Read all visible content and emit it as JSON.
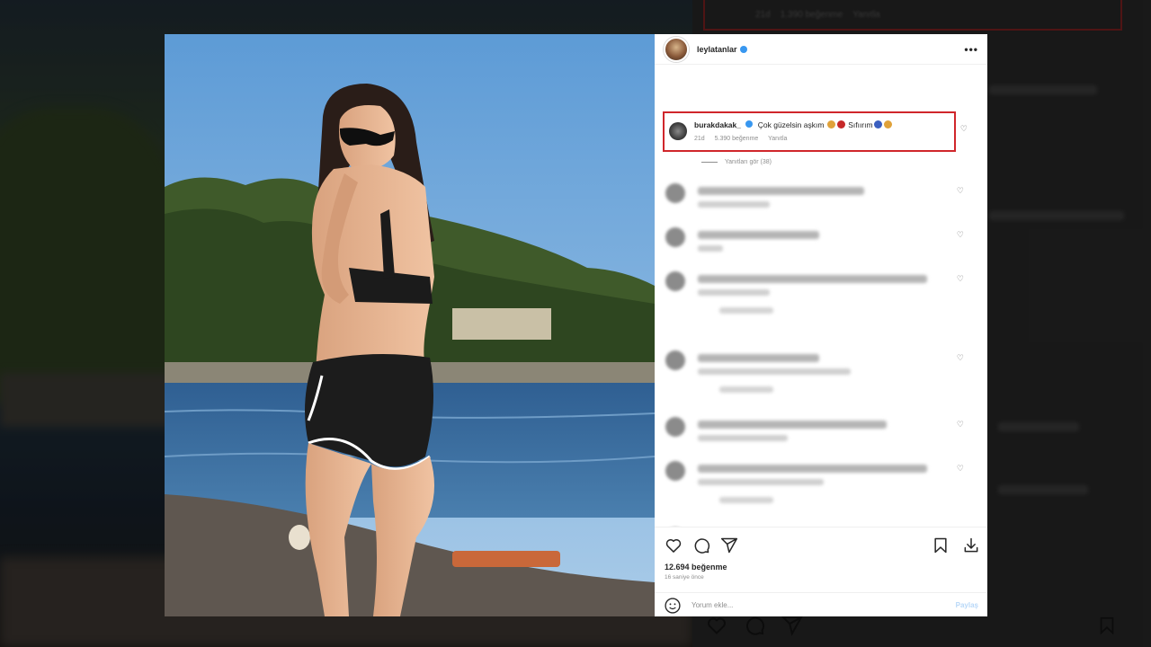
{
  "post": {
    "username": "leylatanlar",
    "menu_glyph": "•••",
    "likes": "12.694 beğenme",
    "date": "16 saniye önce",
    "add_comment_placeholder": "Yorum ekle...",
    "share_label": "Paylaş"
  },
  "highlighted_comment": {
    "username": "burakdakak_",
    "text": "Çok güzelsin aşkım",
    "text_tail": "Sıfıırım",
    "time": "21d",
    "likes": "5.390 beğenme",
    "reply_label": "Yanıtla",
    "view_replies": "Yanıtları gör (38)",
    "emoji_colors": [
      "#e0a23a",
      "#c62828",
      "#e0a23a",
      "#3b5fc0",
      "#e0a23a"
    ]
  },
  "background": {
    "meta_line": "21d    1.390 beğenme    Yanıtla"
  },
  "icons": [
    "heart-icon",
    "comment-icon",
    "share-icon",
    "bookmark-icon",
    "download-icon",
    "smile-icon",
    "more-icon"
  ],
  "colors": {
    "highlight_border": "#d0262b",
    "verified": "#3897f0",
    "share_disabled": "#b8d8f8"
  }
}
